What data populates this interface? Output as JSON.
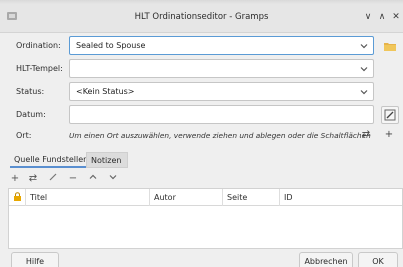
{
  "window": {
    "title": "HLT Ordinationseditor - Gramps",
    "icon": "gramps-app-icon",
    "controls": [
      "minimize",
      "maximize",
      "close"
    ]
  },
  "form": {
    "ordination": {
      "label": "Ordination:",
      "value": "Sealed to Spouse"
    },
    "temple": {
      "label": "HLT-Tempel:",
      "value": ""
    },
    "status": {
      "label": "Status:",
      "value": "<Kein Status>"
    },
    "date": {
      "label": "Datum:",
      "value": ""
    },
    "place": {
      "label": "Ort:",
      "hint": "Um einen Ort auszuwählen, verwende ziehen und ablegen oder die Schaltflächen"
    }
  },
  "tabs": [
    {
      "label": "Quelle Fundstellen",
      "active": true
    },
    {
      "label": "Notizen",
      "active": false
    }
  ],
  "toolbar": {
    "add": "+",
    "share": "share",
    "edit": "edit",
    "remove": "−",
    "up": "up",
    "down": "down"
  },
  "table": {
    "columns": [
      "Titel",
      "Autor",
      "Seite",
      "ID"
    ],
    "rows": []
  },
  "buttons": {
    "help": "Hilfe",
    "cancel": "Abbrechen",
    "ok": "OK"
  },
  "colors": {
    "accent": "#5b9bd5",
    "lock_icon": "#e8a800"
  }
}
